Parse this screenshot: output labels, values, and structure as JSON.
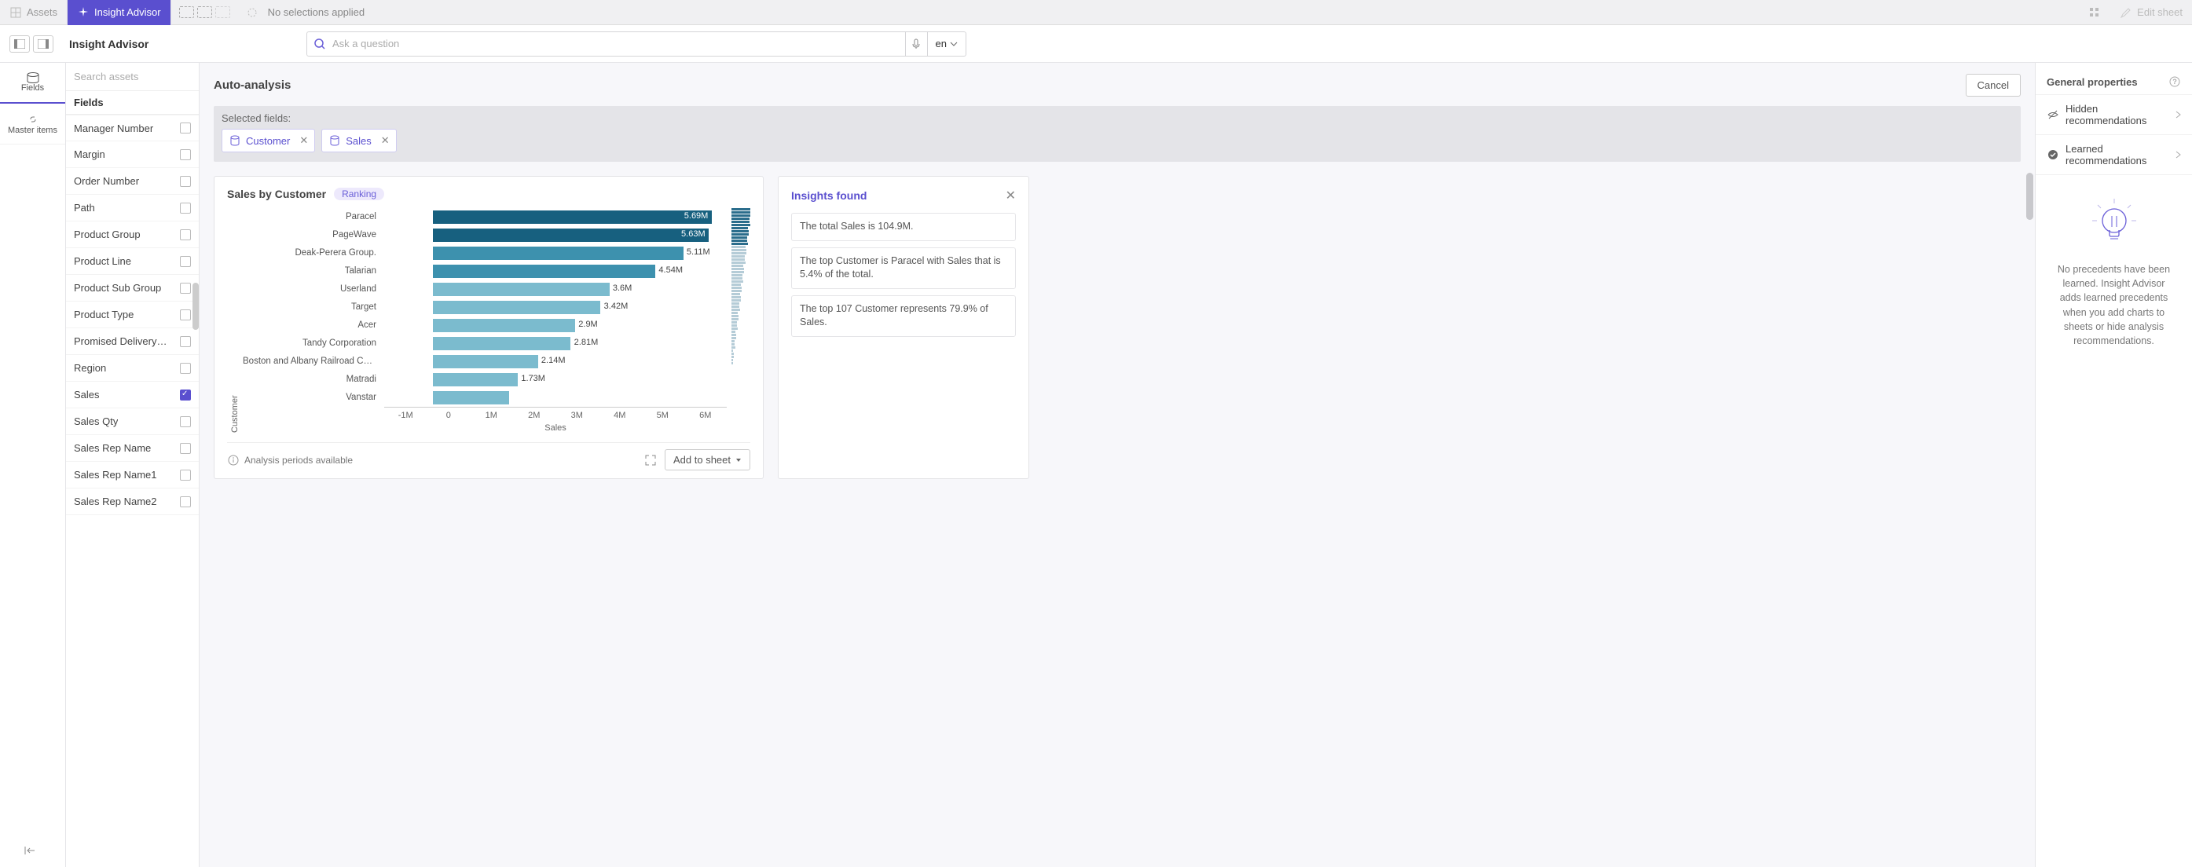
{
  "topbar": {
    "assets": "Assets",
    "insight_advisor": "Insight Advisor",
    "no_selections": "No selections applied",
    "edit_sheet": "Edit sheet"
  },
  "header": {
    "title": "Insight Advisor",
    "search_placeholder": "Ask a question",
    "lang": "en"
  },
  "leftcol": {
    "fields": "Fields",
    "master_items": "Master items"
  },
  "fieldspanel": {
    "search_placeholder": "Search assets",
    "header": "Fields",
    "items": [
      {
        "label": "Manager Number",
        "checked": false
      },
      {
        "label": "Margin",
        "checked": false
      },
      {
        "label": "Order Number",
        "checked": false
      },
      {
        "label": "Path",
        "checked": false
      },
      {
        "label": "Product Group",
        "checked": false
      },
      {
        "label": "Product Line",
        "checked": false
      },
      {
        "label": "Product Sub Group",
        "checked": false
      },
      {
        "label": "Product Type",
        "checked": false
      },
      {
        "label": "Promised Delivery D...",
        "checked": false
      },
      {
        "label": "Region",
        "checked": false
      },
      {
        "label": "Sales",
        "checked": true
      },
      {
        "label": "Sales Qty",
        "checked": false
      },
      {
        "label": "Sales Rep Name",
        "checked": false
      },
      {
        "label": "Sales Rep Name1",
        "checked": false
      },
      {
        "label": "Sales Rep Name2",
        "checked": false
      }
    ]
  },
  "center": {
    "title": "Auto-analysis",
    "cancel": "Cancel",
    "selected_label": "Selected fields:",
    "tokens": [
      "Customer",
      "Sales"
    ]
  },
  "chart": {
    "title": "Sales by Customer",
    "badge": "Ranking",
    "ylabel": "Customer",
    "xlabel": "Sales",
    "foot_left": "Analysis periods available",
    "add_btn": "Add to sheet"
  },
  "chart_data": {
    "type": "bar",
    "orientation": "horizontal",
    "ylabel": "Customer",
    "xlabel": "Sales",
    "xlim": [
      -1000000,
      6000000
    ],
    "xticks": [
      "-1M",
      "0",
      "1M",
      "2M",
      "3M",
      "4M",
      "5M",
      "6M"
    ],
    "series": [
      {
        "name": "Sales",
        "values": [
          5690000,
          5630000,
          5110000,
          4540000,
          3600000,
          3420000,
          2900000,
          2810000,
          2140000,
          1730000,
          1550000
        ]
      }
    ],
    "categories": [
      "Paracel",
      "PageWave",
      "Deak-Perera Group.",
      "Talarian",
      "Userland",
      "Target",
      "Acer",
      "Tandy Corporation",
      "Boston and Albany Railroad Company",
      "Matradi",
      "Vanstar"
    ],
    "value_labels": [
      "5.69M",
      "5.63M",
      "5.11M",
      "4.54M",
      "3.6M",
      "3.42M",
      "2.9M",
      "2.81M",
      "2.14M",
      "1.73M",
      ""
    ],
    "colors": [
      "#17607f",
      "#17607f",
      "#3d91ae",
      "#3d91ae",
      "#7bbbce",
      "#7bbbce",
      "#7bbbce",
      "#7bbbce",
      "#7bbbce",
      "#7bbbce",
      "#7bbbce"
    ]
  },
  "insights": {
    "title": "Insights found",
    "items": [
      "The total Sales is 104.9M.",
      "The top Customer is Paracel with Sales that is 5.4% of the total.",
      "The top 107 Customer represents 79.9% of Sales."
    ]
  },
  "rightpanel": {
    "gp": "General properties",
    "hidden": "Hidden recommendations",
    "learned": "Learned recommendations",
    "bulb_text": "No precedents have been learned. Insight Advisor adds learned precedents when you add charts to sheets or hide analysis recommendations."
  }
}
